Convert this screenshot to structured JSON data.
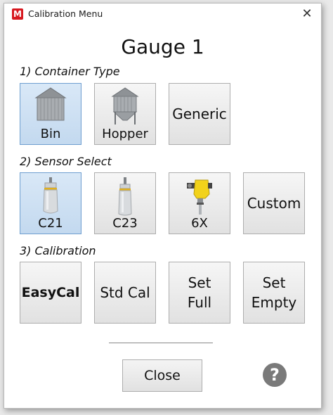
{
  "window": {
    "title": "Calibration Menu",
    "logo_letter": "M",
    "close_glyph": "✕"
  },
  "heading": "Gauge 1",
  "sections": [
    {
      "label": "1) Container Type",
      "buttons": [
        {
          "label": "Bin",
          "icon": "bin-silo-icon",
          "selected": true
        },
        {
          "label": "Hopper",
          "icon": "hopper-silo-icon",
          "selected": false
        },
        {
          "label": "Generic",
          "icon": null,
          "selected": false
        }
      ]
    },
    {
      "label": "2) Sensor Select",
      "buttons": [
        {
          "label": "C21",
          "icon": "c21-sensor-icon",
          "selected": true
        },
        {
          "label": "C23",
          "icon": "c23-sensor-icon",
          "selected": false
        },
        {
          "label": "6X",
          "icon": "6x-sensor-icon",
          "selected": false
        },
        {
          "label": "Custom",
          "icon": null,
          "selected": false
        }
      ]
    },
    {
      "label": "3) Calibration",
      "buttons": [
        {
          "label": "EasyCal",
          "icon": null,
          "selected": false
        },
        {
          "label": "Std Cal",
          "icon": null,
          "selected": false
        },
        {
          "label": "Set\nFull",
          "icon": null,
          "selected": false
        },
        {
          "label": "Set\nEmpty",
          "icon": null,
          "selected": false
        }
      ]
    }
  ],
  "footer": {
    "close_label": "Close",
    "help_glyph": "?"
  },
  "colors": {
    "selected_bg": "#c8dcf1",
    "selected_border": "#6f9fd0",
    "logo_red": "#d71920",
    "help_gray": "#7a7a7a"
  }
}
